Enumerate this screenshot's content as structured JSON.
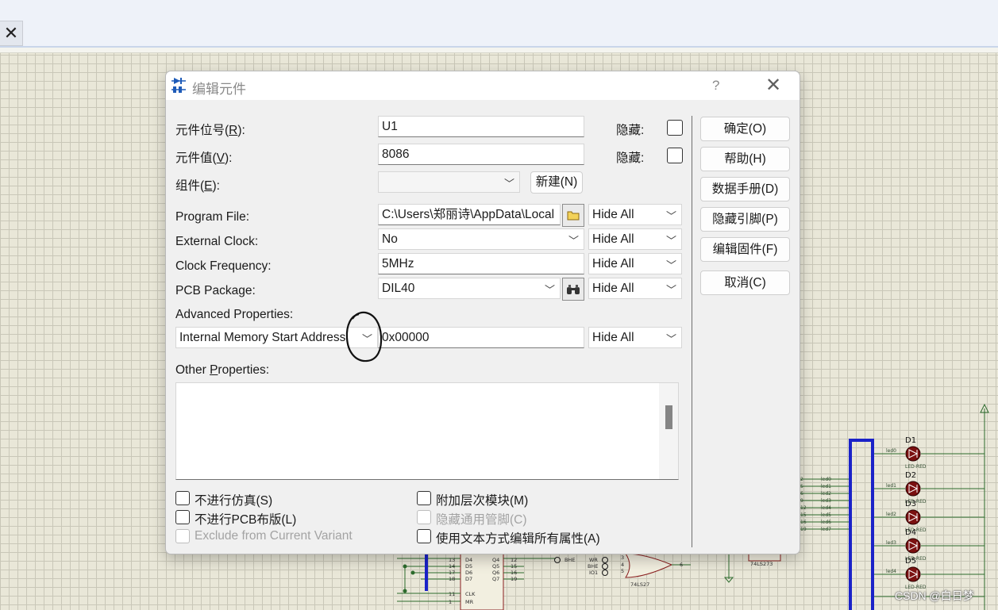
{
  "dialog": {
    "title": "编辑元件",
    "help_glyph": "?",
    "close_glyph": "✕",
    "labels": {
      "ref_pre": "元件位号(",
      "ref_key": "R",
      "ref_post": "):",
      "val_pre": "元件值(",
      "val_key": "V",
      "val_post": "):",
      "grp_pre": "组件(",
      "grp_key": "E",
      "grp_post": "):",
      "program_file": "Program File:",
      "external_clock": "External Clock:",
      "clock_frequency": "Clock Frequency:",
      "pcb_package": "PCB Package:",
      "advanced_properties": "Advanced Properties:",
      "other_pre": "Other ",
      "other_key": "P",
      "other_post": "roperties:",
      "hidden": "隐藏:"
    },
    "fields": {
      "ref": "U1",
      "value": "8086",
      "group": "",
      "program_file": "C:\\Users\\郑丽诗\\AppData\\Local",
      "external_clock": "No",
      "clock_frequency": "5MHz",
      "pcb_package": "DIL40",
      "advanced_property": "Internal Memory Start Address",
      "advanced_value": "0x00000"
    },
    "hide_options": {
      "program_file": "Hide All",
      "external_clock": "Hide All",
      "clock_frequency": "Hide All",
      "pcb_package": "Hide All",
      "advanced": "Hide All"
    },
    "new_button": "新建(N)",
    "side_buttons": [
      "确定(O)",
      "帮助(H)",
      "数据手册(D)",
      "隐藏引脚(P)",
      "编辑固件(F)",
      "取消(C)"
    ],
    "checkboxes": [
      {
        "label": "不进行仿真(S)",
        "checked": false,
        "enabled": true
      },
      {
        "label": "不进行PCB布版(L)",
        "checked": false,
        "enabled": true
      },
      {
        "label": "Exclude from Current Variant",
        "checked": false,
        "enabled": false
      },
      {
        "label": "附加层次模块(M)",
        "checked": false,
        "enabled": true
      },
      {
        "label": "隐藏通用管脚(C)",
        "checked": false,
        "enabled": false
      },
      {
        "label": "使用文本方式编辑所有属性(A)",
        "checked": false,
        "enabled": true
      }
    ]
  },
  "schematic": {
    "leds": [
      {
        "ref": "D1",
        "part": "LED-RED",
        "net": "led0"
      },
      {
        "ref": "D2",
        "part": "LED-RED",
        "net": "led1"
      },
      {
        "ref": "D3",
        "part": "LED-RED",
        "net": "led2"
      },
      {
        "ref": "D4",
        "part": "LED-RED",
        "net": "led3"
      },
      {
        "ref": "D5",
        "part": "LED-RED",
        "net": "led4"
      }
    ],
    "bus_nets": [
      "led0",
      "led1",
      "led2",
      "led3",
      "led4",
      "led5",
      "led6",
      "led7"
    ],
    "bus_pins": [
      "2",
      "5",
      "6",
      "9",
      "12",
      "15",
      "16",
      "19"
    ],
    "chip_labels": [
      "74LS273",
      "74LS27"
    ],
    "latch_pins_left": [
      "13",
      "14",
      "17",
      "18",
      "11",
      "1"
    ],
    "latch_names_left": [
      "D4",
      "D5",
      "D6",
      "D7",
      "CLK",
      "MR"
    ],
    "latch_names_right": [
      "Q4",
      "Q5",
      "Q6",
      "Q7"
    ],
    "latch_pins_right": [
      "12",
      "15",
      "16",
      "19"
    ],
    "gate_inputs": [
      "BHE",
      "WR",
      "BHE",
      "IO1"
    ],
    "gate_pins": [
      "3",
      "4",
      "5",
      "6"
    ]
  },
  "watermark": "CSDN @白日梦"
}
